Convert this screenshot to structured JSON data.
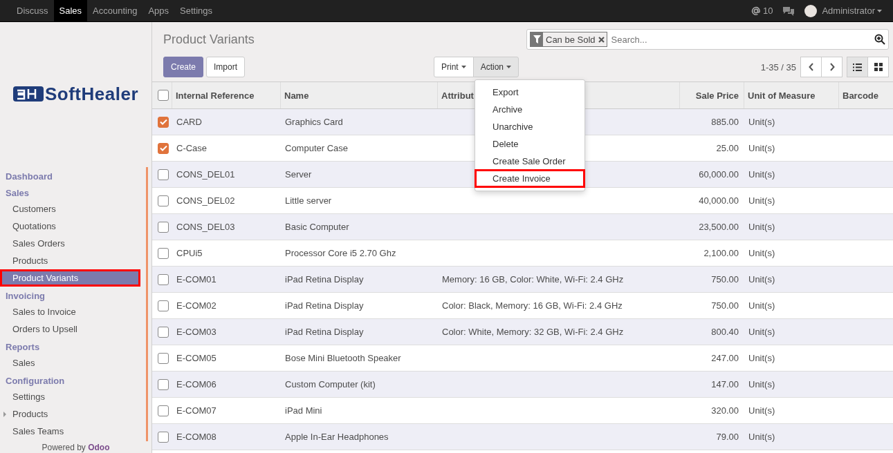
{
  "top_nav": {
    "apps": [
      {
        "label": "Discuss",
        "selected": false
      },
      {
        "label": "Sales",
        "selected": true
      },
      {
        "label": "Accounting",
        "selected": false
      },
      {
        "label": "Apps",
        "selected": false
      },
      {
        "label": "Settings",
        "selected": false
      }
    ],
    "mentions": "10",
    "user": "Administrator"
  },
  "sidebar": {
    "logo": "SoftHealer",
    "sections": [
      {
        "title": "Dashboard"
      },
      {
        "title": "Sales",
        "items": [
          {
            "label": "Customers",
            "selected": false,
            "highlighted": false,
            "expandable": false
          },
          {
            "label": "Quotations",
            "selected": false,
            "highlighted": false,
            "expandable": false
          },
          {
            "label": "Sales Orders",
            "selected": false,
            "highlighted": false,
            "expandable": false
          },
          {
            "label": "Products",
            "selected": false,
            "highlighted": false,
            "expandable": false
          },
          {
            "label": "Product Variants",
            "selected": true,
            "highlighted": true,
            "expandable": false
          }
        ]
      },
      {
        "title": "Invoicing",
        "items": [
          {
            "label": "Sales to Invoice",
            "selected": false,
            "highlighted": false,
            "expandable": false
          },
          {
            "label": "Orders to Upsell",
            "selected": false,
            "highlighted": false,
            "expandable": false
          }
        ]
      },
      {
        "title": "Reports",
        "items": [
          {
            "label": "Sales",
            "selected": false,
            "highlighted": false,
            "expandable": false
          }
        ]
      },
      {
        "title": "Configuration",
        "items": [
          {
            "label": "Settings",
            "selected": false,
            "highlighted": false,
            "expandable": false
          },
          {
            "label": "Products",
            "selected": false,
            "highlighted": false,
            "expandable": true
          },
          {
            "label": "Sales Teams",
            "selected": false,
            "highlighted": false,
            "expandable": false
          }
        ]
      }
    ],
    "footer": "Powered by **Odoo**"
  },
  "header": {
    "title": "Product Variants",
    "buttons": [
      "Create",
      "Import"
    ],
    "print": "Print",
    "action": "Action",
    "action_open": true,
    "filter": "Can be Sold",
    "search_placeholder": "Search...",
    "pager": "1-35 / 35",
    "views": [
      {
        "kind": "list",
        "selected": true
      },
      {
        "kind": "kanban",
        "selected": false
      }
    ]
  },
  "action_menu": [
    {
      "label": "Export",
      "highlighted": false
    },
    {
      "label": "Archive",
      "highlighted": false
    },
    {
      "label": "Unarchive",
      "highlighted": false
    },
    {
      "label": "Delete",
      "highlighted": false
    },
    {
      "label": "Create Sale Order",
      "highlighted": false
    },
    {
      "label": "Create Invoice",
      "highlighted": true
    }
  ],
  "table": {
    "select_all": false,
    "columns": [
      "Internal Reference",
      "Name",
      "Attribut",
      "Sale Price",
      "Unit of Measure",
      "Barcode"
    ],
    "rows": [
      {
        "ref": "CARD",
        "name": "Graphics Card",
        "price": "885.00",
        "uom": "Unit(s)",
        "selected": true
      },
      {
        "ref": "C-Case",
        "name": "Computer Case",
        "price": "25.00",
        "uom": "Unit(s)",
        "selected": true
      },
      {
        "ref": "CONS_DEL01",
        "name": "Server",
        "price": "60,000.00",
        "uom": "Unit(s)",
        "selected": false
      },
      {
        "ref": "CONS_DEL02",
        "name": "Little server",
        "price": "40,000.00",
        "uom": "Unit(s)",
        "selected": false
      },
      {
        "ref": "CONS_DEL03",
        "name": "Basic Computer",
        "price": "23,500.00",
        "uom": "Unit(s)",
        "selected": false
      },
      {
        "ref": "CPUi5",
        "name": "Processor Core i5 2.70 Ghz",
        "price": "2,100.00",
        "uom": "Unit(s)",
        "selected": false
      },
      {
        "ref": "E-COM01",
        "name": "iPad Retina Display",
        "attributes": "Memory: 16 GB, Color: White, Wi-Fi: 2.4 GHz",
        "price": "750.00",
        "uom": "Unit(s)",
        "selected": false
      },
      {
        "ref": "E-COM02",
        "name": "iPad Retina Display",
        "attributes": "Color: Black, Memory: 16 GB, Wi-Fi: 2.4 GHz",
        "price": "750.00",
        "uom": "Unit(s)",
        "selected": false
      },
      {
        "ref": "E-COM03",
        "name": "iPad Retina Display",
        "attributes": "Color: White, Memory: 32 GB, Wi-Fi: 2.4 GHz",
        "price": "800.40",
        "uom": "Unit(s)",
        "selected": false
      },
      {
        "ref": "E-COM05",
        "name": "Bose Mini Bluetooth Speaker",
        "price": "247.00",
        "uom": "Unit(s)",
        "selected": false
      },
      {
        "ref": "E-COM06",
        "name": "Custom Computer (kit)",
        "price": "147.00",
        "uom": "Unit(s)",
        "selected": false
      },
      {
        "ref": "E-COM07",
        "name": "iPad Mini",
        "price": "320.00",
        "uom": "Unit(s)",
        "selected": false
      },
      {
        "ref": "E-COM08",
        "name": "Apple In-Ear Headphones",
        "price": "79.00",
        "uom": "Unit(s)",
        "selected": false
      }
    ]
  }
}
